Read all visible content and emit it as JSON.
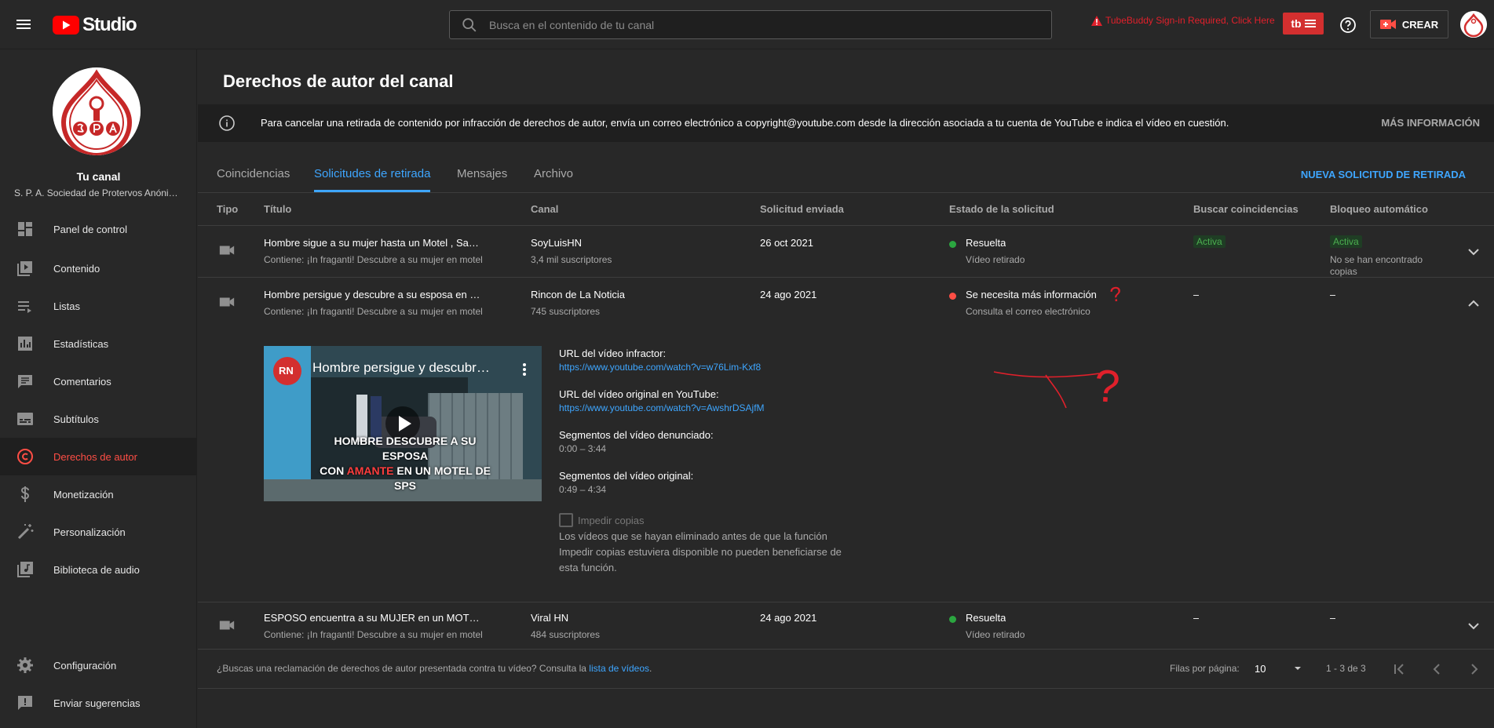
{
  "topbar": {
    "logo_text": "Studio",
    "search_placeholder": "Busca en el contenido de tu canal",
    "tubebuddy_warning": "TubeBuddy Sign-in Required, Click Here",
    "create_label": "CREAR"
  },
  "sidebar": {
    "channel_title": "Tu canal",
    "channel_name": "S. P. A. Sociedad de Protervos Anónimos",
    "items": [
      {
        "label": "Panel de control",
        "icon": "dashboard-icon"
      },
      {
        "label": "Contenido",
        "icon": "content-icon"
      },
      {
        "label": "Listas",
        "icon": "playlist-icon"
      },
      {
        "label": "Estadísticas",
        "icon": "analytics-icon"
      },
      {
        "label": "Comentarios",
        "icon": "comments-icon"
      },
      {
        "label": "Subtítulos",
        "icon": "subtitles-icon"
      },
      {
        "label": "Derechos de autor",
        "icon": "copyright-icon",
        "active": true
      },
      {
        "label": "Monetización",
        "icon": "dollar-icon"
      },
      {
        "label": "Personalización",
        "icon": "magic-wand-icon"
      },
      {
        "label": "Biblioteca de audio",
        "icon": "audio-library-icon"
      }
    ],
    "bottom_items": [
      {
        "label": "Configuración",
        "icon": "gear-icon"
      },
      {
        "label": "Enviar sugerencias",
        "icon": "feedback-icon"
      }
    ]
  },
  "page": {
    "title": "Derechos de autor del canal",
    "info_text": "Para cancelar una retirada de contenido por infracción de derechos de autor, envía un correo electrónico a copyright@youtube.com desde la dirección asociada a tu cuenta de YouTube e indica el vídeo en cuestión.",
    "info_more": "MÁS INFORMACIÓN",
    "tabs": [
      "Coincidencias",
      "Solicitudes de retirada",
      "Mensajes",
      "Archivo"
    ],
    "active_tab": "Solicitudes de retirada",
    "new_request": "NUEVA SOLICITUD DE RETIRADA"
  },
  "table": {
    "headers": [
      "Tipo",
      "Título",
      "Canal",
      "Solicitud enviada",
      "Estado de la solicitud",
      "Buscar coincidencias",
      "Bloqueo automático"
    ],
    "rows": [
      {
        "title": "Hombre sigue a su mujer hasta un Motel , San Pedro Sula",
        "subtitle": "Contiene: ¡In fraganti! Descubre a su mujer en motel",
        "channel": "SoyLuisHN",
        "subscribers": "3,4 mil suscriptores",
        "date": "26 oct 2021",
        "status": "Resuelta",
        "status_detail": "Vídeo retirado",
        "status_color": "#2ba640",
        "match": "Activa",
        "block": "Activa",
        "block_detail": "No se han encontrado copias"
      },
      {
        "title": "Hombre persigue y descubre a su esposa en un motel",
        "subtitle": "Contiene: ¡In fraganti! Descubre a su mujer en motel",
        "channel": "Rincon de La Noticia",
        "subscribers": "745 suscriptores",
        "date": "24 ago 2021",
        "status": "Se necesita más información",
        "status_detail": "Consulta el correo electrónico",
        "status_color": "#ff4e45",
        "match": "–",
        "block": "–"
      },
      {
        "title": "ESPOSO encuentra a su MUJER en un MOTEL de SPS",
        "subtitle": "Contiene: ¡In fraganti! Descubre a su mujer en motel",
        "channel": "Viral HN",
        "subscribers": "484 suscriptores",
        "date": "24 ago 2021",
        "status": "Resuelta",
        "status_detail": "Vídeo retirado",
        "status_color": "#2ba640",
        "match": "–",
        "block": "–"
      }
    ]
  },
  "details": {
    "thumb_channel_badge": "RN",
    "thumb_title": "Hombre persigue y descubre a su esposa en un motel",
    "thumb_caption_1": "HOMBRE DESCUBRE A SU ESPOSA",
    "thumb_caption_2a": "CON",
    "thumb_caption_2b": "AMANTE",
    "thumb_caption_2c": "EN UN MOTEL DE",
    "thumb_caption_3": "SPS",
    "infringing_label": "URL del vídeo infractor:",
    "infringing_url": "https://www.youtube.com/watch?v=w76Lim-Kxf8",
    "original_label": "URL del vídeo original en YouTube:",
    "original_url": "https://www.youtube.com/watch?v=AwshrDSAjfM",
    "reported_segments_label": "Segmentos del vídeo denunciado:",
    "reported_segments": "0:00 – 3:44",
    "original_segments_label": "Segmentos del vídeo original:",
    "original_segments": "0:49 – 4:34",
    "prevent_copies_label": "Impedir copias",
    "prevent_copies_note": "Los vídeos que se hayan eliminado antes de que la función Impedir copias estuviera disponible no pueden beneficiarse de esta función."
  },
  "annotation_marks": [
    "?",
    "?"
  ],
  "footer": {
    "text": "¿Buscas una reclamación de derechos de autor presentada contra tu vídeo? Consulta la ",
    "link": "lista de vídeos",
    "text_end": ".",
    "rows_label": "Filas por página:",
    "rows_value": "10",
    "range": "1 - 3 de 3"
  },
  "colors": {
    "accent": "#3ea6ff",
    "brand_red": "#ff0000",
    "active_red": "#ff4e45",
    "success": "#2ba640"
  }
}
